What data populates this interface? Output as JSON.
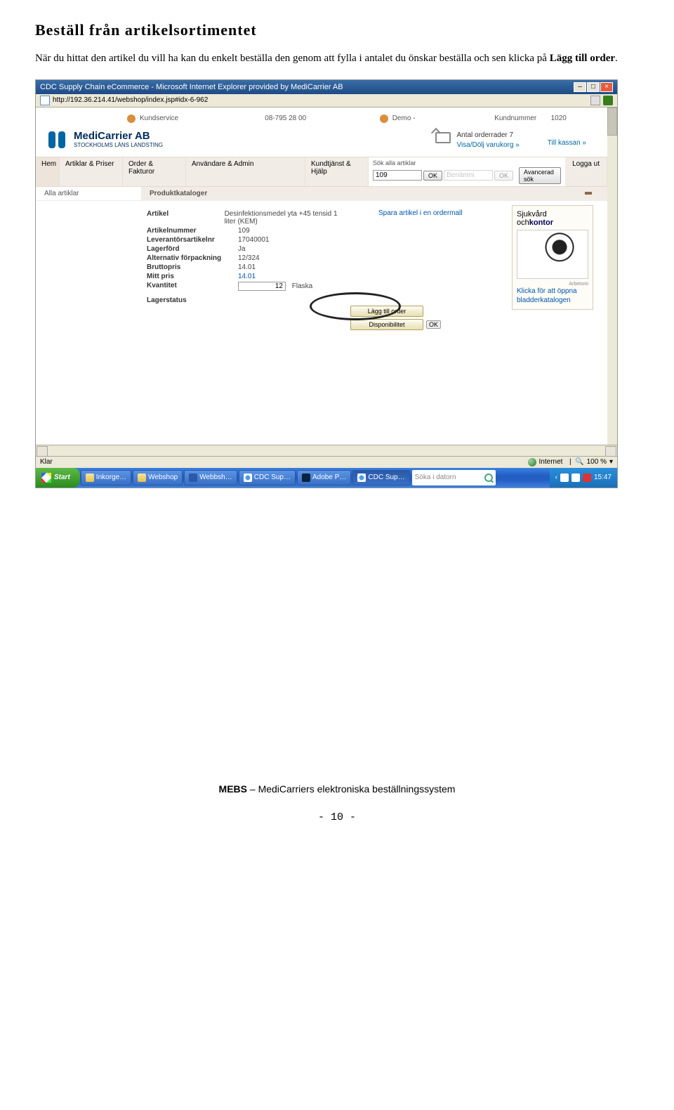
{
  "doc": {
    "heading": "Beställ från artikelsortimentet",
    "paragraph_pre": "När du hittat den artikel du vill ha kan du enkelt beställa den genom att fylla i antalet du önskar beställa och sen klicka på ",
    "paragraph_bold": "Lägg till order",
    "paragraph_post": "."
  },
  "browser": {
    "title": "CDC Supply Chain eCommerce - Microsoft Internet Explorer provided by MediCarrier AB",
    "url": "http://192.36.214.41/webshop/index.jsp#idx-6-962"
  },
  "topinfo": {
    "kundservice": "Kundservice",
    "phone": "08-795 28 00",
    "demo": "Demo -",
    "kundnummer_label": "Kundnummer",
    "kundnummer_value": "1020"
  },
  "logo": {
    "name": "MediCarrier AB",
    "sub": "STOCKHOLMS LÄNS LANDSTING"
  },
  "cart": {
    "rows_label": "Antal orderrader 7",
    "show_hide": "Visa/Dölj varukorg »",
    "to_checkout": "Till kassan »"
  },
  "nav": {
    "hem": "Hem",
    "artiklar": "Artiklar & Priser",
    "order": "Order & Fakturor",
    "anvandare": "Användare & Admin",
    "kundtjanst": "Kundtjänst & Hjälp",
    "search_label": "Sök alla artiklar",
    "search_value": "109",
    "ok": "OK",
    "benamn_placeholder": "Benämni",
    "advanced": "Avancerad sök",
    "logout": "Logga ut"
  },
  "subnav": {
    "left": "Alla artiklar",
    "right": "Produktkataloger"
  },
  "product": {
    "labels": {
      "artikel": "Artikel",
      "artikelnummer": "Artikelnummer",
      "levartnr": "Leverantörsartikelnr",
      "lagerford": "Lagerförd",
      "altpack": "Alternativ förpackning",
      "bruttopris": "Bruttopris",
      "mittpris": "Mitt pris",
      "kvantitet": "Kvantitet",
      "lagerstatus": "Lagerstatus"
    },
    "values": {
      "artikel": "Desinfektionsmedel yta +45 tensid 1 liter (KEM)",
      "artikelnummer": "109",
      "levartnr": "17040001",
      "lagerford": "Ja",
      "altpack": "12/324",
      "bruttopris": "14.01",
      "mittpris": "14.01",
      "kvantitet": "12",
      "unit": "Flaska"
    },
    "save_link": "Spara artikel i en ordermall",
    "btn_add": "Lägg till order",
    "btn_disp": "Disponibilitet",
    "ok_after": "OK"
  },
  "sidebox": {
    "title_pre": "Sjukvård",
    "title_post": " och",
    "title_bold": "kontor",
    "pub": "Arbetsmi",
    "link": "Klicka för att öppna bladderkatalogen"
  },
  "status": {
    "klar": "Klar",
    "zone": "Internet",
    "zoom": "100 %"
  },
  "taskbar": {
    "start": "Start",
    "items": [
      "Inkorge…",
      "Webshop",
      "Webbsh…",
      "CDC Sup…",
      "Adobe P…",
      "CDC Sup…"
    ],
    "search_placeholder": "Söka i datorn",
    "time": "15:47"
  },
  "footer": {
    "text": "MEBS – MediCarriers elektroniska beställningssystem",
    "page": "- 10 -"
  }
}
